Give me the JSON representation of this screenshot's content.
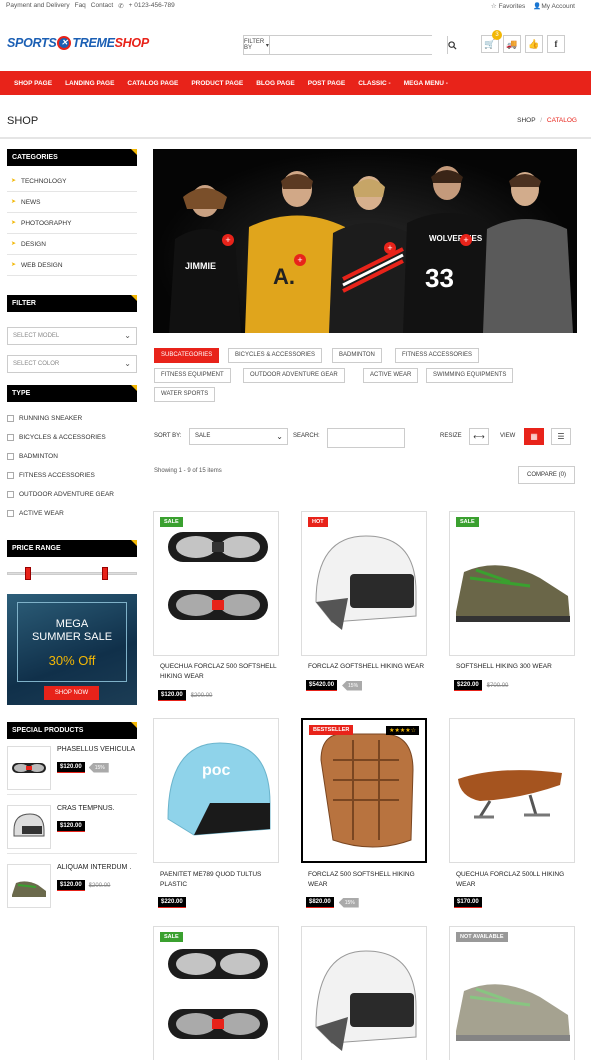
{
  "topbar": {
    "links": [
      "Payment and Delivery",
      "Faq",
      "Contact"
    ],
    "phone": "+ 0123-456-789",
    "favorites": "Favorites",
    "account": "My Account"
  },
  "header": {
    "logo_part1": "SPORTS",
    "logo_part2": "TREME",
    "logo_part3": "SHOP",
    "filter_by": "FILTER BY",
    "cart_count": "3"
  },
  "nav": [
    "SHOP PAGE",
    "LANDING PAGE",
    "CATALOG PAGE",
    "PRODUCT PAGE",
    "BLOG PAGE",
    "POST PAGE",
    "CLASSIC -",
    "MEGA MENU -"
  ],
  "page": {
    "title": "SHOP",
    "breadcrumb_home": "SHOP",
    "breadcrumb_sep": "/",
    "breadcrumb_current": "CATALOG"
  },
  "sidebar": {
    "categories_title": "CATEGORIES",
    "categories": [
      "TECHNOLOGY",
      "NEWS",
      "PHOTOGRAPHY",
      "DESIGN",
      "WEB DESIGN"
    ],
    "filter_title": "FILTER",
    "select_model": "SELECT MODEL",
    "select_color": "SELECT COLOR",
    "type_title": "TYPE",
    "types": [
      "RUNNING SNEAKER",
      "BICYCLES & ACCESSORIES",
      "BADMINTON",
      "FITNESS ACCESSORIES",
      "OUTDOOR ADVENTURE GEAR",
      "ACTIVE WEAR"
    ],
    "price_range_title": "PRICE RANGE",
    "banner": {
      "line1": "MEGA",
      "line2": "SUMMER SALE",
      "line3": "30% Off",
      "button": "SHOP NOW"
    },
    "special_title": "SPECIAL PRODUCTS",
    "special": [
      {
        "name": "PHASELLUS VEHICULA",
        "price": "$120.00",
        "old": "",
        "discount": "15%"
      },
      {
        "name": "CRAS TEMPNUS.",
        "price": "$120.00",
        "old": "",
        "discount": ""
      },
      {
        "name": "ALIQUAM INTERDUM .",
        "price": "$120.00",
        "old": "$200.00",
        "discount": ""
      }
    ]
  },
  "subcategories": [
    "SUBCATEGORIES",
    "BICYCLES & ACCESSORIES",
    "BADMINTON",
    "FITNESS ACCESSORIES",
    "FITNESS EQUIPMENT",
    "OUTDOOR ADVENTURE GEAR",
    "ACTIVE WEAR",
    "SWIMMING EQUIPMENTS",
    "WATER SPORTS"
  ],
  "toolbar": {
    "sort_label": "SORT BY:",
    "sort_value": "SALE",
    "search_label": "SEARCH:",
    "resize_label": "RESIZE",
    "view_label": "VIEW",
    "showing": "Showing 1 - 9 of 15 items",
    "compare": "COMPARE (0)"
  },
  "products": [
    {
      "name": "QUECHUA FORCLAZ 500 SOFTSHELL HIKING WEAR",
      "price": "$120.00",
      "old": "$200.00",
      "discount": "",
      "label": "SALE",
      "stars": ""
    },
    {
      "name": "FORCLAZ GOFTSHELL HIKING WEAR",
      "price": "$5420.00",
      "old": "",
      "discount": "15%",
      "label": "HOT",
      "stars": ""
    },
    {
      "name": "SOFTSHELL HIKING 300 WEAR",
      "price": "$220.00",
      "old": "$700.00",
      "discount": "",
      "label": "SALE",
      "stars": ""
    },
    {
      "name": "PAENITET ME789 QUOD TULTUS PLASTIC",
      "price": "$220.00",
      "old": "",
      "discount": "",
      "label": "",
      "stars": ""
    },
    {
      "name": "FORCLAZ 500 SOFTSHELL HIKING WEAR",
      "price": "$820.00",
      "old": "",
      "discount": "15%",
      "label": "BESTSELLER",
      "stars": "★★★★☆"
    },
    {
      "name": "QUECHUA FORCLAZ 500LL HIKING WEAR",
      "price": "$170.00",
      "old": "",
      "discount": "",
      "label": "",
      "stars": ""
    },
    {
      "name": "",
      "price": "",
      "old": "",
      "discount": "",
      "label": "SALE",
      "stars": ""
    },
    {
      "name": "",
      "price": "",
      "old": "",
      "discount": "",
      "label": "",
      "stars": ""
    },
    {
      "name": "",
      "price": "",
      "old": "",
      "discount": "",
      "label": "NOT AVAILABLE",
      "stars": ""
    }
  ],
  "colors": {
    "accent": "#e8231a",
    "brand_blue": "#1b5fb4",
    "sale_green": "#3aa02f",
    "gold": "#f2b705"
  }
}
